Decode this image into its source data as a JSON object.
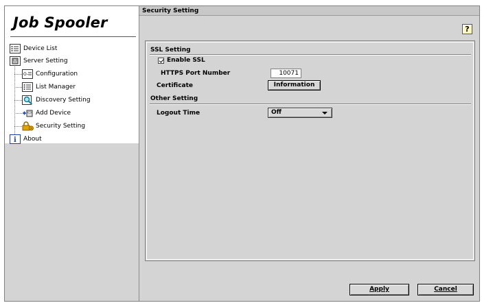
{
  "app": {
    "title": "Job Spooler"
  },
  "tree": {
    "device_list": "Device List",
    "server_setting": "Server Setting",
    "configuration": "Configuration",
    "list_manager": "List Manager",
    "discovery_setting": "Discovery Setting",
    "add_device": "Add Device",
    "security_setting": "Security Setting",
    "about": "About"
  },
  "header": {
    "title": "Security Setting",
    "help": "?"
  },
  "ssl": {
    "section": "SSL Setting",
    "enable_label": "Enable SSL",
    "enable_checked": true,
    "https_port_label": "HTTPS Port Number",
    "https_port_value": "10071",
    "certificate_label": "Certificate",
    "information_button": "Information"
  },
  "other": {
    "section": "Other Setting",
    "logout_label": "Logout Time",
    "logout_value": "Off"
  },
  "footer": {
    "apply": "Apply",
    "cancel": "Cancel"
  },
  "colors": {
    "background": "#d4d4d4",
    "pane": "#ffffff",
    "help_bg": "#fff9c0",
    "about_icon": "#1a3fb0"
  }
}
